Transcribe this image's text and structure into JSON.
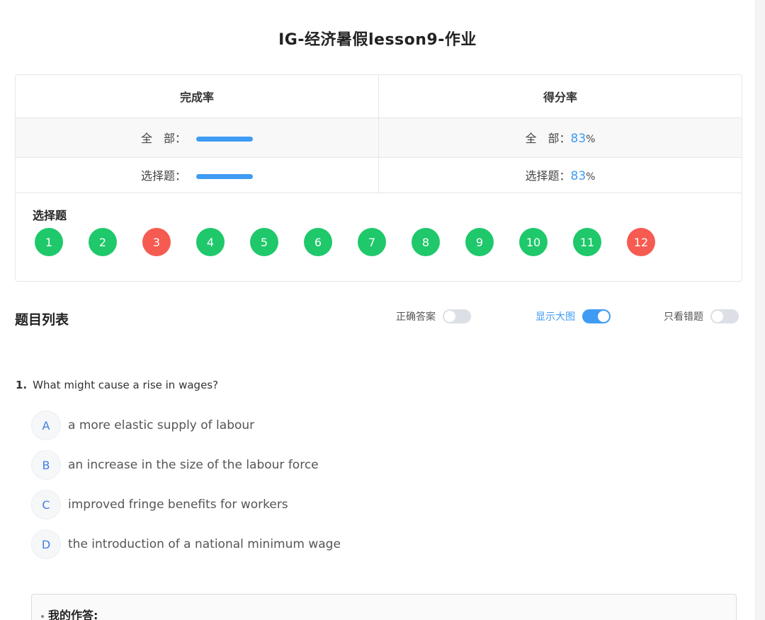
{
  "page": {
    "title": "IG-经济暑假lesson9-作业"
  },
  "stats": {
    "completion_header": "完成率",
    "score_header": "得分率",
    "rows": [
      {
        "label": "全　部：",
        "completion_pct": 100,
        "score_value": "83",
        "score_unit": "%"
      },
      {
        "label": "选择题：",
        "completion_pct": 100,
        "score_value": "83",
        "score_unit": "%"
      }
    ]
  },
  "question_nav": {
    "title": "选择题",
    "items": [
      {
        "number": "1",
        "status": "correct"
      },
      {
        "number": "2",
        "status": "correct"
      },
      {
        "number": "3",
        "status": "wrong"
      },
      {
        "number": "4",
        "status": "correct"
      },
      {
        "number": "5",
        "status": "correct"
      },
      {
        "number": "6",
        "status": "correct"
      },
      {
        "number": "7",
        "status": "correct"
      },
      {
        "number": "8",
        "status": "correct"
      },
      {
        "number": "9",
        "status": "correct"
      },
      {
        "number": "10",
        "status": "correct"
      },
      {
        "number": "11",
        "status": "correct"
      },
      {
        "number": "12",
        "status": "wrong"
      }
    ]
  },
  "list": {
    "title": "题目列表",
    "toggles": [
      {
        "label": "正确答案",
        "on": false
      },
      {
        "label": "显示大图",
        "on": true
      },
      {
        "label": "只看错题",
        "on": false
      }
    ]
  },
  "question": {
    "number": "1.",
    "text": "What might cause a rise in wages?",
    "options": [
      {
        "letter": "A",
        "text": "a more elastic supply of labour"
      },
      {
        "letter": "B",
        "text": "an increase in the size of the labour force"
      },
      {
        "letter": "C",
        "text": "improved fringe benefits for workers"
      },
      {
        "letter": "D",
        "text": "the introduction of a national minimum wage"
      }
    ],
    "answer_label": "我的作答:"
  },
  "colors": {
    "accent": "#3f9bf4",
    "correct": "#1fc86a",
    "wrong": "#f65b52"
  }
}
